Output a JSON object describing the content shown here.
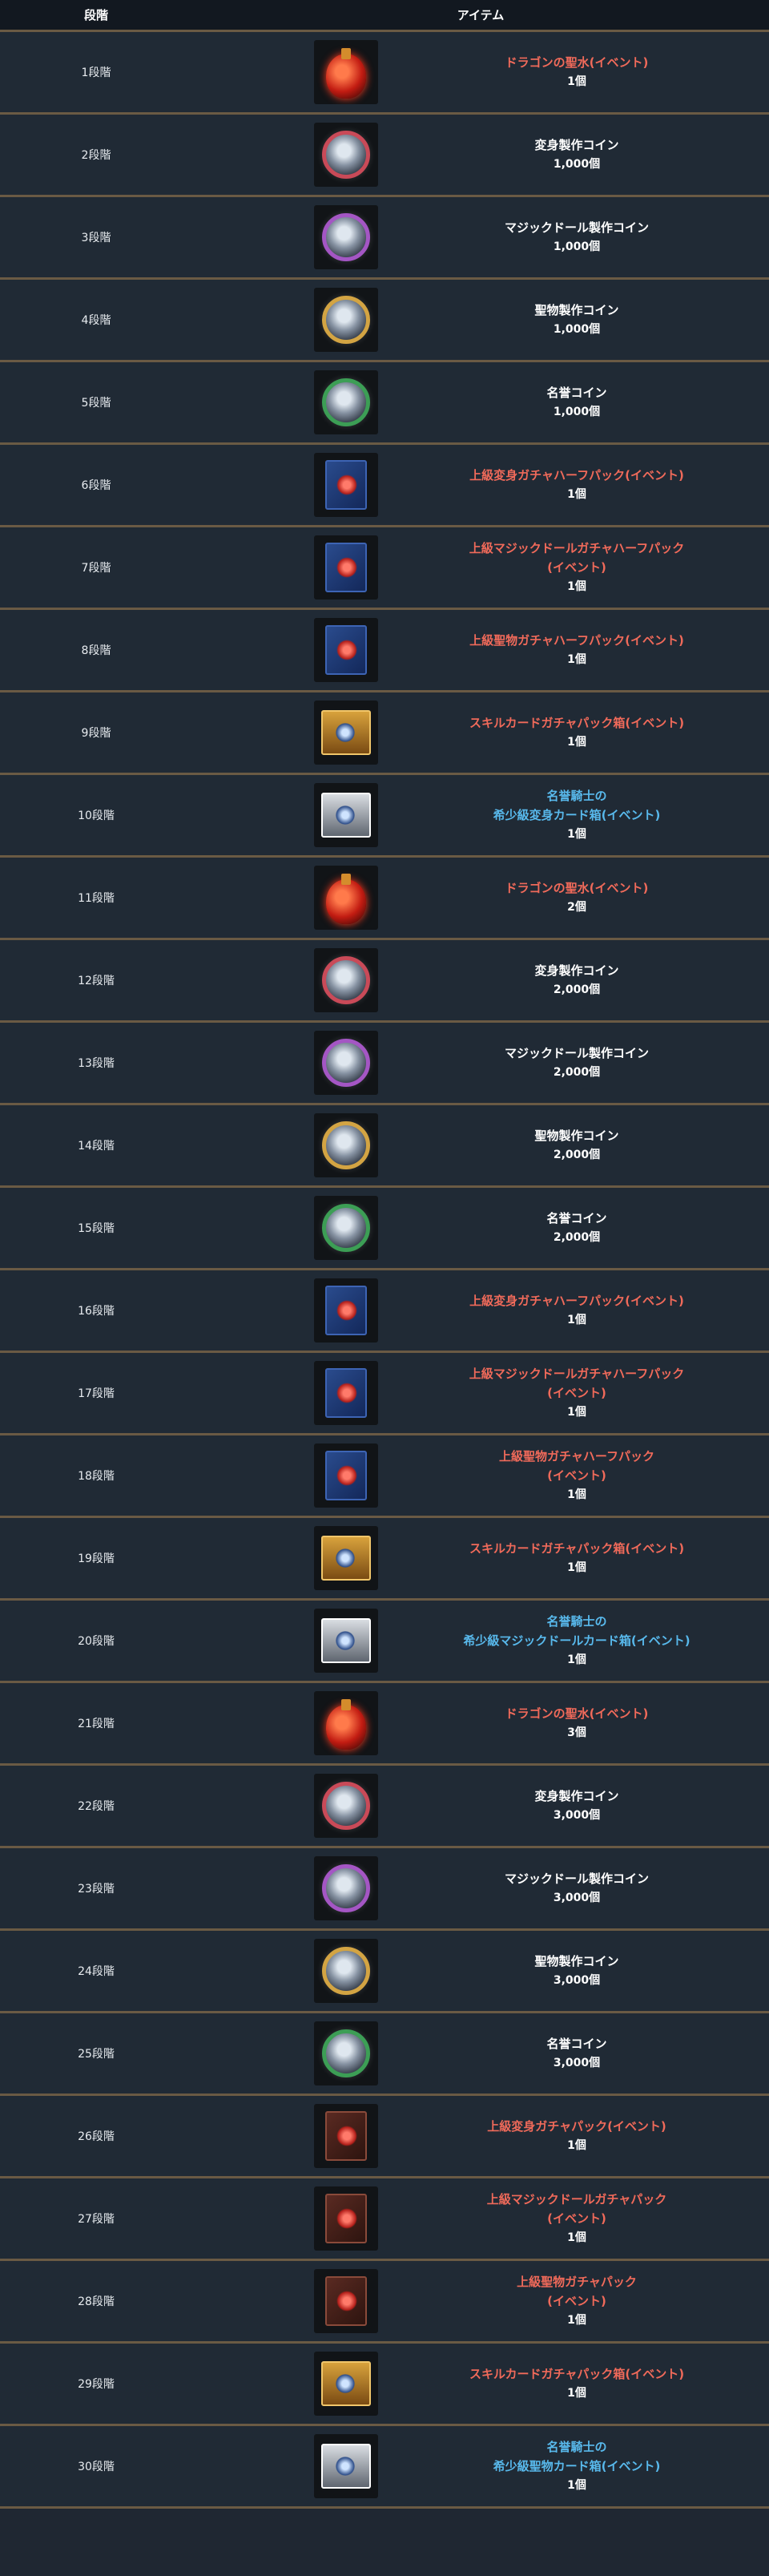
{
  "header": {
    "col_step": "段階",
    "col_item": "アイテム"
  },
  "rows": [
    {
      "step": "1段階",
      "icon": "dragon-water-icon",
      "name": "ドラゴンの聖水(イベント)",
      "qty": "1個",
      "color": "red"
    },
    {
      "step": "2段階",
      "icon": "transform-coin-icon",
      "name": "変身製作コイン",
      "qty": "1,000個",
      "color": "white"
    },
    {
      "step": "3段階",
      "icon": "magic-doll-coin-icon",
      "name": "マジックドール製作コイン",
      "qty": "1,000個",
      "color": "white"
    },
    {
      "step": "4段階",
      "icon": "holy-item-coin-icon",
      "name": "聖物製作コイン",
      "qty": "1,000個",
      "color": "white"
    },
    {
      "step": "5段階",
      "icon": "honor-coin-icon",
      "name": "名誉コイン",
      "qty": "1,000個",
      "color": "white"
    },
    {
      "step": "6段階",
      "icon": "card-pack-icon",
      "name": "上級変身ガチャハーフパック(イベント)",
      "qty": "1個",
      "color": "red"
    },
    {
      "step": "7段階",
      "icon": "card-pack-icon",
      "name": "上級マジックドールガチャハーフパック\n(イベント)",
      "qty": "1個",
      "color": "red"
    },
    {
      "step": "8段階",
      "icon": "card-pack-icon",
      "name": "上級聖物ガチャハーフパック(イベント)",
      "qty": "1個",
      "color": "red"
    },
    {
      "step": "9段階",
      "icon": "skill-card-box-icon",
      "name": "スキルカードガチャパック箱(イベント)",
      "qty": "1個",
      "color": "red"
    },
    {
      "step": "10段階",
      "icon": "rare-card-box-icon",
      "name": "名誉騎士の\n希少級変身カード箱(イベント)",
      "qty": "1個",
      "color": "blue"
    },
    {
      "step": "11段階",
      "icon": "dragon-water-icon",
      "name": "ドラゴンの聖水(イベント)",
      "qty": "2個",
      "color": "red"
    },
    {
      "step": "12段階",
      "icon": "transform-coin-icon",
      "name": "変身製作コイン",
      "qty": "2,000個",
      "color": "white"
    },
    {
      "step": "13段階",
      "icon": "magic-doll-coin-icon",
      "name": "マジックドール製作コイン",
      "qty": "2,000個",
      "color": "white"
    },
    {
      "step": "14段階",
      "icon": "holy-item-coin-icon",
      "name": "聖物製作コイン",
      "qty": "2,000個",
      "color": "white"
    },
    {
      "step": "15段階",
      "icon": "honor-coin-icon",
      "name": "名誉コイン",
      "qty": "2,000個",
      "color": "white"
    },
    {
      "step": "16段階",
      "icon": "card-pack-icon",
      "name": "上級変身ガチャハーフパック(イベント)",
      "qty": "1個",
      "color": "red"
    },
    {
      "step": "17段階",
      "icon": "card-pack-icon",
      "name": "上級マジックドールガチャハーフパック\n(イベント)",
      "qty": "1個",
      "color": "red"
    },
    {
      "step": "18段階",
      "icon": "card-pack-icon",
      "name": "上級聖物ガチャハーフパック\n(イベント)",
      "qty": "1個",
      "color": "red"
    },
    {
      "step": "19段階",
      "icon": "skill-card-box-icon",
      "name": "スキルカードガチャパック箱(イベント)",
      "qty": "1個",
      "color": "red"
    },
    {
      "step": "20段階",
      "icon": "rare-card-box-icon",
      "name": "名誉騎士の\n希少級マジックドールカード箱(イベント)",
      "qty": "1個",
      "color": "blue"
    },
    {
      "step": "21段階",
      "icon": "dragon-water-icon",
      "name": "ドラゴンの聖水(イベント)",
      "qty": "3個",
      "color": "red"
    },
    {
      "step": "22段階",
      "icon": "transform-coin-icon",
      "name": "変身製作コイン",
      "qty": "3,000個",
      "color": "white"
    },
    {
      "step": "23段階",
      "icon": "magic-doll-coin-icon",
      "name": "マジックドール製作コイン",
      "qty": "3,000個",
      "color": "white"
    },
    {
      "step": "24段階",
      "icon": "holy-item-coin-icon",
      "name": "聖物製作コイン",
      "qty": "3,000個",
      "color": "white"
    },
    {
      "step": "25段階",
      "icon": "honor-coin-icon",
      "name": "名誉コイン",
      "qty": "3,000個",
      "color": "white"
    },
    {
      "step": "26段階",
      "icon": "gacha-pack-icon",
      "name": "上級変身ガチャパック(イベント)",
      "qty": "1個",
      "color": "red"
    },
    {
      "step": "27段階",
      "icon": "gacha-pack-icon",
      "name": "上級マジックドールガチャパック\n(イベント)",
      "qty": "1個",
      "color": "red"
    },
    {
      "step": "28段階",
      "icon": "gacha-pack-icon",
      "name": "上級聖物ガチャパック\n(イベント)",
      "qty": "1個",
      "color": "red"
    },
    {
      "step": "29段階",
      "icon": "skill-card-box-icon",
      "name": "スキルカードガチャパック箱(イベント)",
      "qty": "1個",
      "color": "red"
    },
    {
      "step": "30段階",
      "icon": "rare-card-box-icon",
      "name": "名誉騎士の\n希少級聖物カード箱(イベント)",
      "qty": "1個",
      "color": "blue"
    }
  ]
}
